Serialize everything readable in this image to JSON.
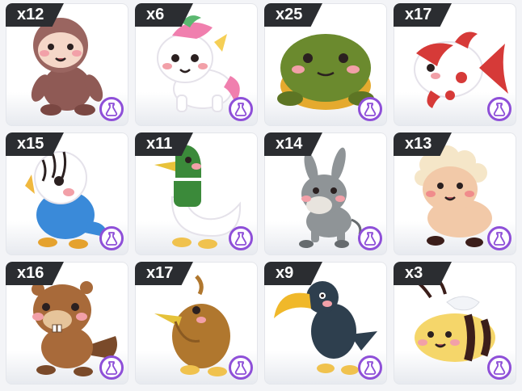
{
  "badge_icon": "potion-icon",
  "badge_color": "#8e4fd8",
  "pets": [
    {
      "name": "sloth",
      "quantity": "x12"
    },
    {
      "name": "unicorn",
      "quantity": "x6"
    },
    {
      "name": "frog",
      "quantity": "x25"
    },
    {
      "name": "goldfish",
      "quantity": "x17"
    },
    {
      "name": "budgie",
      "quantity": "x15"
    },
    {
      "name": "mallard-duck",
      "quantity": "x11"
    },
    {
      "name": "donkey",
      "quantity": "x14"
    },
    {
      "name": "sheep",
      "quantity": "x13"
    },
    {
      "name": "beaver",
      "quantity": "x16"
    },
    {
      "name": "kiwi",
      "quantity": "x17"
    },
    {
      "name": "toucan",
      "quantity": "x9"
    },
    {
      "name": "bee",
      "quantity": "x3"
    }
  ]
}
